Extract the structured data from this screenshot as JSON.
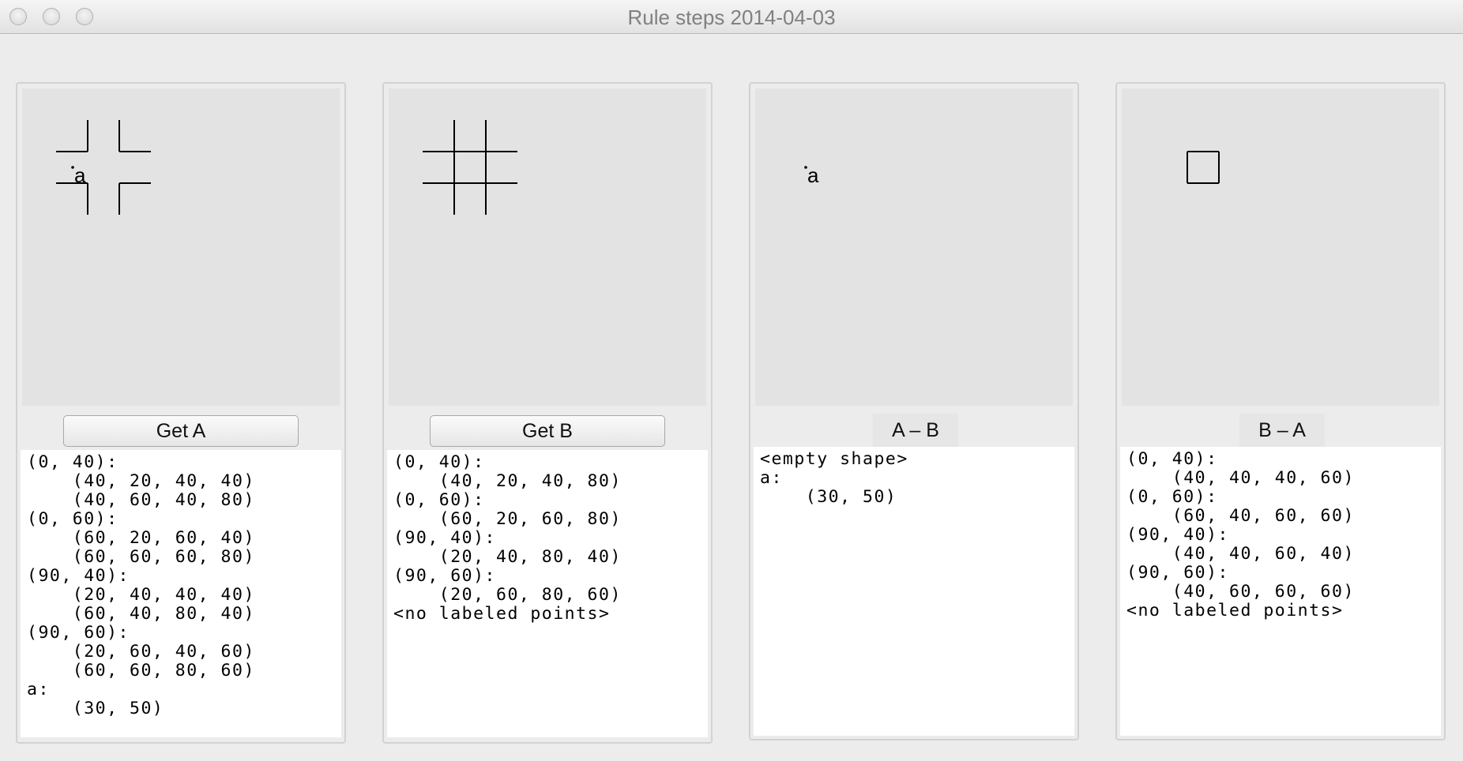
{
  "window": {
    "title": "Rule steps 2014-04-03"
  },
  "panels": [
    {
      "button_label": "Get A",
      "point_label": "a",
      "output": "(0, 40):\n    (40, 20, 40, 40)\n    (40, 60, 40, 80)\n(0, 60):\n    (60, 20, 60, 40)\n    (60, 60, 60, 80)\n(90, 40):\n    (20, 40, 40, 40)\n    (60, 40, 80, 40)\n(90, 60):\n    (20, 60, 40, 60)\n    (60, 60, 80, 60)\na:\n    (30, 50)"
    },
    {
      "button_label": "Get B",
      "output": "(0, 40):\n    (40, 20, 40, 80)\n(0, 60):\n    (60, 20, 60, 80)\n(90, 40):\n    (20, 40, 80, 40)\n(90, 60):\n    (20, 60, 80, 60)\n<no labeled points>"
    },
    {
      "label": "A – B",
      "point_label": "a",
      "output": "<empty shape>\na:\n    (30, 50)"
    },
    {
      "label": "B – A",
      "output": "(0, 40):\n    (40, 40, 40, 60)\n(0, 60):\n    (60, 40, 60, 60)\n(90, 40):\n    (40, 40, 60, 40)\n(90, 60):\n    (40, 60, 60, 60)\n<no labeled points>"
    }
  ]
}
